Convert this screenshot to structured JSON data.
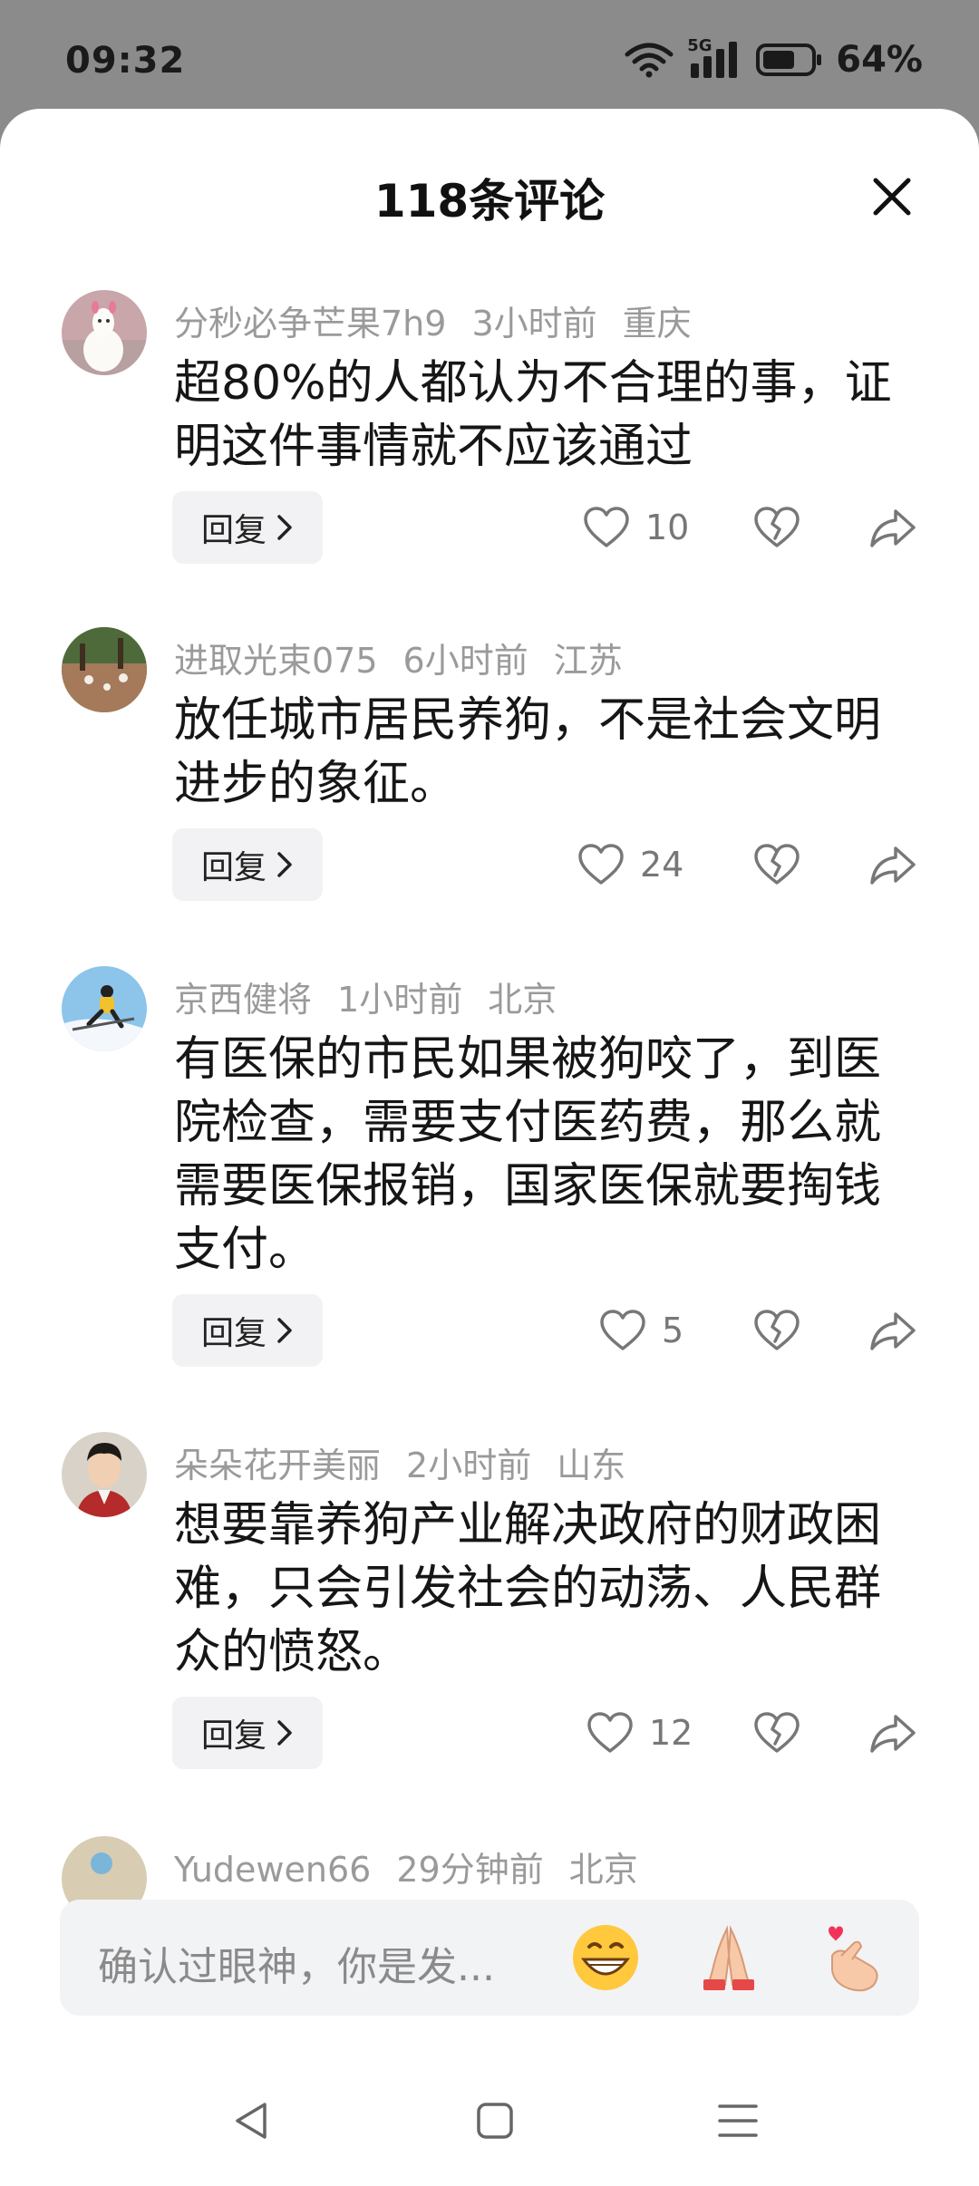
{
  "status_bar": {
    "time": "09:32",
    "network": "5G",
    "battery_percent": "64%"
  },
  "sheet": {
    "title": "118条评论"
  },
  "comments": [
    {
      "username": "分秒必争芒果7h9",
      "time": "3小时前",
      "location": "重庆",
      "text": "超80%的人都认为不合理的事，证明这件事情就不应该通过",
      "reply_label": "回复",
      "likes": "10"
    },
    {
      "username": "进取光束075",
      "time": "6小时前",
      "location": "江苏",
      "text": "放任城市居民养狗，不是社会文明进步的象征。",
      "reply_label": "回复",
      "likes": "24"
    },
    {
      "username": "京西健将",
      "time": "1小时前",
      "location": "北京",
      "text": "有医保的市民如果被狗咬了，到医院检查，需要支付医药费，那么就需要医保报销，国家医保就要掏钱支付。",
      "reply_label": "回复",
      "likes": "5"
    },
    {
      "username": "朵朵花开美丽",
      "time": "2小时前",
      "location": "山东",
      "text": "想要靠养狗产业解决政府的财政困难，只会引发社会的动荡、人民群众的愤怒。",
      "reply_label": "回复",
      "likes": "12"
    },
    {
      "username": "Yudewen66",
      "time": "29分钟前",
      "location": "北京"
    }
  ],
  "input": {
    "placeholder": "确认过眼神，你是发...",
    "emojis": [
      "grinning-face-emoji",
      "folded-hands-emoji",
      "finger-heart-emoji"
    ]
  },
  "navbar": {
    "items": [
      "back-icon",
      "home-icon",
      "menu-icon"
    ]
  },
  "colors": {
    "background_dim": "#8b8b8b",
    "sheet": "#ffffff",
    "meta_text": "#9a9a9a",
    "body_text": "#161616",
    "reply_bg": "#f2f2f4"
  }
}
